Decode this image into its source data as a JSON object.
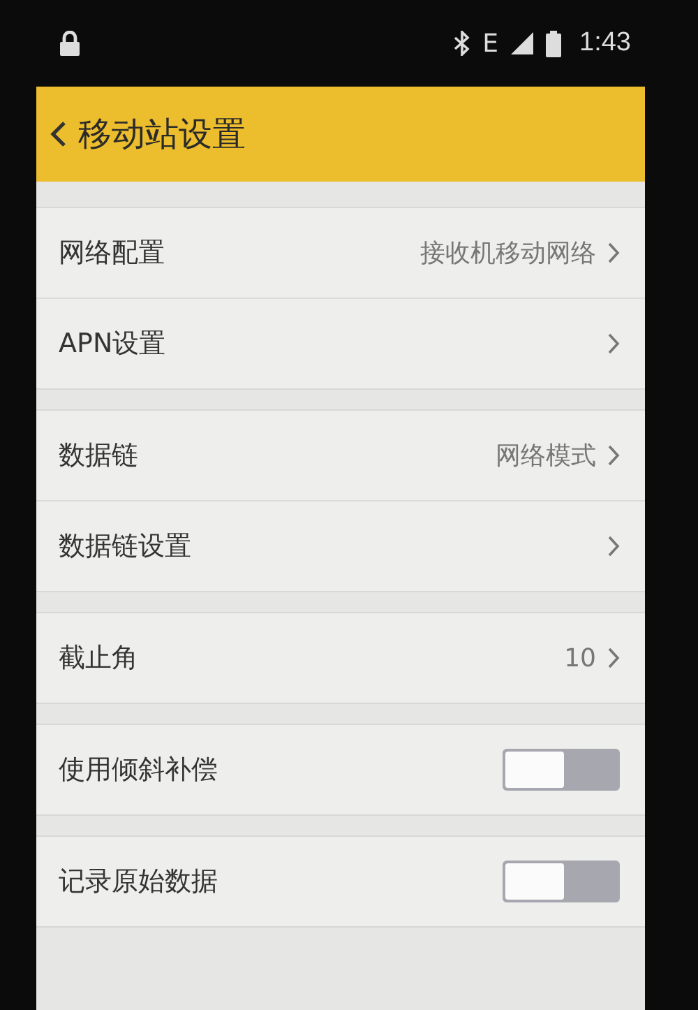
{
  "status_bar": {
    "network": "E",
    "time": "1:43"
  },
  "header": {
    "title": "移动站设置"
  },
  "groups": [
    {
      "items": [
        {
          "kind": "link",
          "label": "网络配置",
          "value": "接收机移动网络"
        },
        {
          "kind": "link",
          "label": "APN设置"
        }
      ]
    },
    {
      "items": [
        {
          "kind": "link",
          "label": "数据链",
          "value": "网络模式"
        },
        {
          "kind": "link",
          "label": "数据链设置"
        }
      ]
    },
    {
      "items": [
        {
          "kind": "link",
          "label": "截止角",
          "value": "10"
        }
      ]
    },
    {
      "items": [
        {
          "kind": "toggle",
          "label": "使用倾斜补偿",
          "on": false
        }
      ]
    },
    {
      "items": [
        {
          "kind": "toggle",
          "label": "记录原始数据",
          "on": false
        }
      ]
    }
  ]
}
